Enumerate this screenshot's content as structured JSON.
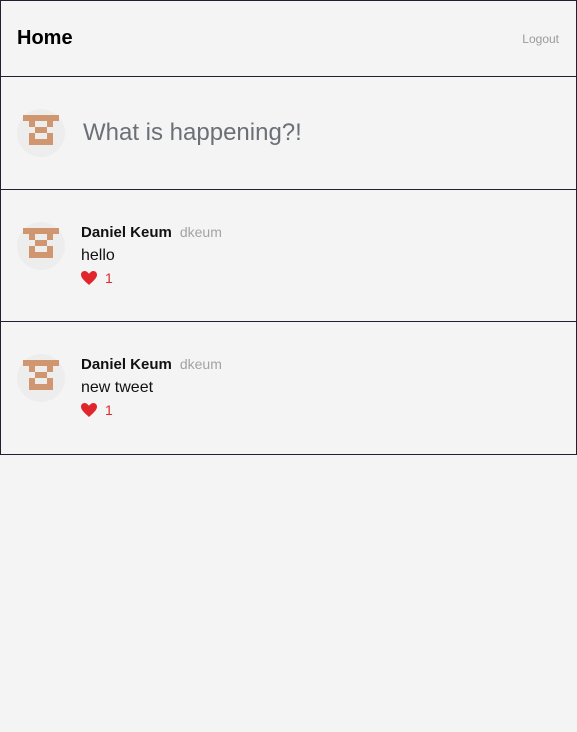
{
  "header": {
    "title": "Home",
    "logout_label": "Logout"
  },
  "composer": {
    "placeholder": "What is happening?!",
    "avatar_icon": "pixel-identicon"
  },
  "tweets": [
    {
      "author_name": "Daniel Keum",
      "author_handle": "dkeum",
      "text": "hello",
      "likes": "1",
      "avatar_icon": "pixel-identicon",
      "like_icon": "heart-icon"
    },
    {
      "author_name": "Daniel Keum",
      "author_handle": "dkeum",
      "text": "new tweet",
      "likes": "1",
      "avatar_icon": "pixel-identicon",
      "like_icon": "heart-icon"
    }
  ],
  "colors": {
    "background": "#f4f4f4",
    "border": "#1f2030",
    "like_red": "#e0262c",
    "avatar_tan": "#cf9670",
    "muted_text": "#a3a3a3"
  }
}
